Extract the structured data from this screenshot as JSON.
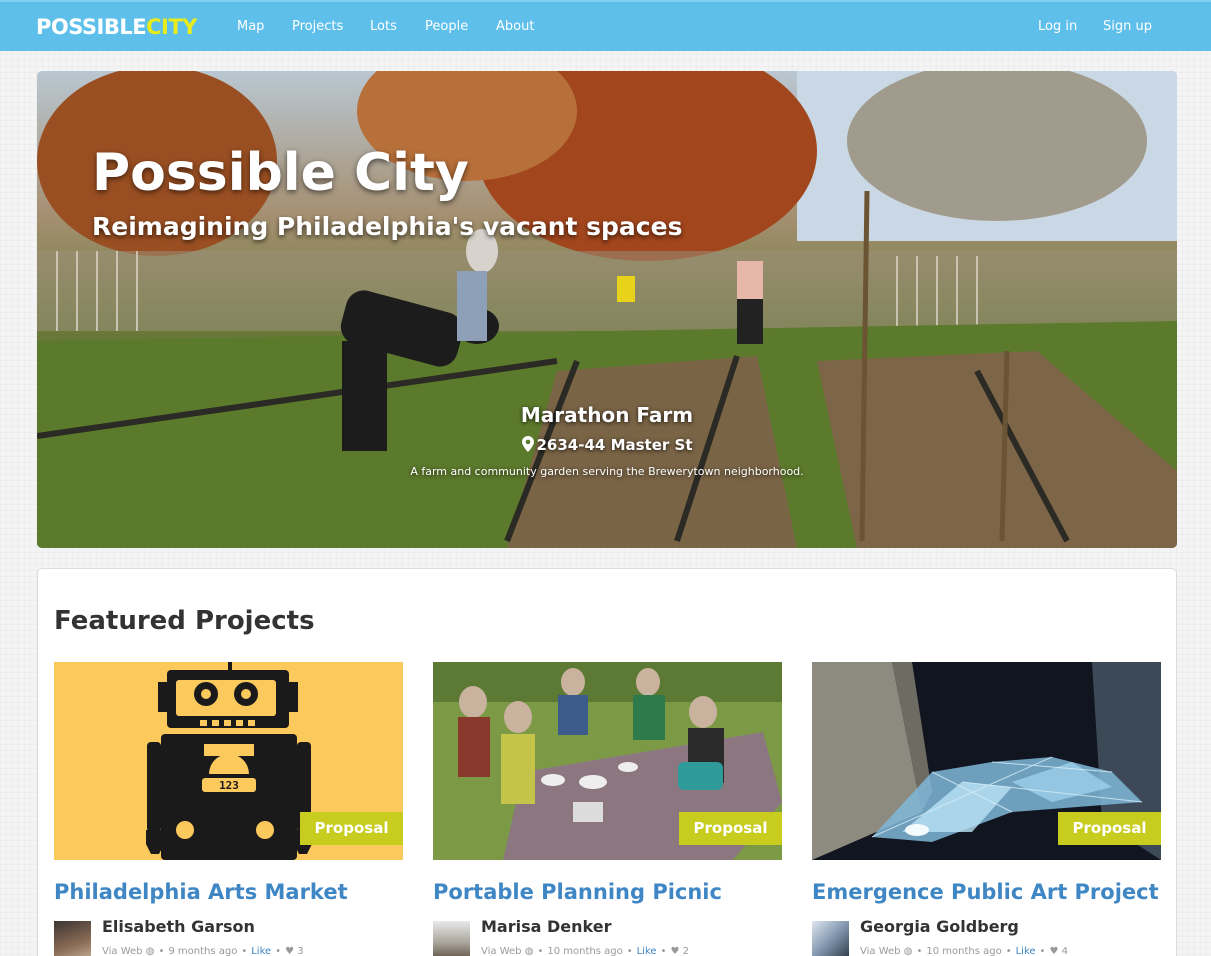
{
  "nav": {
    "brand_part1": "POSSIBLE",
    "brand_part2": "CITY",
    "links": [
      {
        "label": "Map"
      },
      {
        "label": "Projects"
      },
      {
        "label": "Lots"
      },
      {
        "label": "People"
      },
      {
        "label": "About"
      }
    ],
    "login": "Log in",
    "signup": "Sign up"
  },
  "hero": {
    "title": "Possible City",
    "subtitle": "Reimagining Philadelphia's vacant spaces",
    "lot_name": "Marathon Farm",
    "lot_address": "2634-44 Master St",
    "lot_description": "A farm and community garden serving the Brewerytown neighborhood."
  },
  "featured": {
    "heading": "Featured Projects",
    "cards": [
      {
        "title": "Philadelphia Arts Market",
        "badge": "Proposal",
        "author": "Elisabeth Garson",
        "via": "Via Web",
        "time": "9 months ago",
        "like_label": "Like",
        "likes": "3",
        "robot_dial": "123"
      },
      {
        "title": "Portable Planning Picnic",
        "badge": "Proposal",
        "author": "Marisa Denker",
        "via": "Via Web",
        "time": "10 months ago",
        "like_label": "Like",
        "likes": "2"
      },
      {
        "title": "Emergence Public Art Project",
        "badge": "Proposal",
        "author": "Georgia Goldberg",
        "via": "Via Web",
        "time": "10 months ago",
        "like_label": "Like",
        "likes": "4"
      }
    ]
  },
  "colors": {
    "navbar": "#5ec0ea",
    "brand_accent": "#e8ec1a",
    "badge": "#c7cc1e",
    "link": "#3f86c4"
  }
}
